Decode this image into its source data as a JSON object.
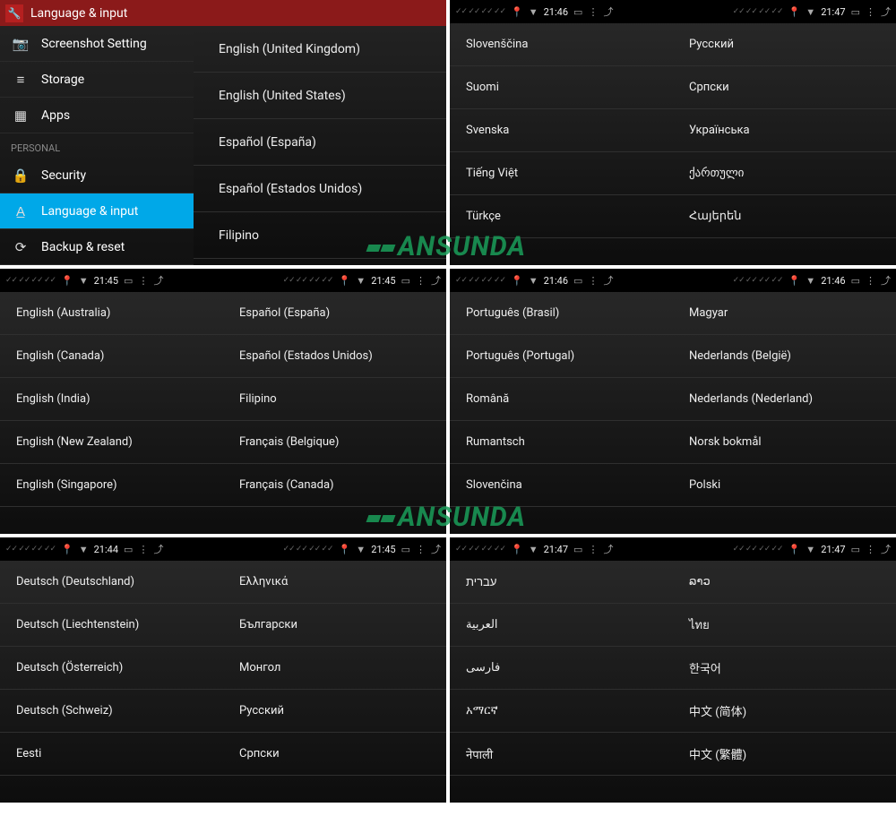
{
  "watermark": "ANSUNDA",
  "panels": {
    "p1": {
      "header": "Language & input",
      "sidebar": {
        "items": [
          {
            "icon": "📷",
            "label": "Screenshot Setting"
          },
          {
            "icon": "≡",
            "label": "Storage"
          },
          {
            "icon": "▦",
            "label": "Apps"
          }
        ],
        "section": "PERSONAL",
        "items2": [
          {
            "icon": "🔒",
            "label": "Security"
          },
          {
            "icon": "A̲",
            "label": "Language & input",
            "active": true
          },
          {
            "icon": "⟳",
            "label": "Backup & reset"
          }
        ]
      },
      "languages": [
        "English (United Kingdom)",
        "English (United States)",
        "Español (España)",
        "Español (Estados Unidos)",
        "Filipino"
      ]
    },
    "p2": {
      "status": {
        "left_time": "21:46",
        "right_time": "21:47"
      },
      "left": [
        "Slovenščina",
        "Suomi",
        "Svenska",
        "Tiếng Việt",
        "Türkçe"
      ],
      "right": [
        "Русский",
        "Српски",
        "Українська",
        "ქართული",
        "Հայերեն"
      ]
    },
    "p3": {
      "status": {
        "left_time": "21:45",
        "right_time": "21:45"
      },
      "left": [
        "English (Australia)",
        "English (Canada)",
        "English (India)",
        "English (New Zealand)",
        "English (Singapore)"
      ],
      "right": [
        "Español (España)",
        "Español (Estados Unidos)",
        "Filipino",
        "Français (Belgique)",
        "Français (Canada)"
      ]
    },
    "p4": {
      "status": {
        "left_time": "21:46",
        "right_time": "21:46"
      },
      "left": [
        "Português (Brasil)",
        "Português (Portugal)",
        "Română",
        "Rumantsch",
        "Slovenčina"
      ],
      "right": [
        "Magyar",
        "Nederlands (België)",
        "Nederlands (Nederland)",
        "Norsk bokmål",
        "Polski"
      ]
    },
    "p5": {
      "status": {
        "left_time": "21:44",
        "right_time": "21:45"
      },
      "left": [
        "Deutsch (Deutschland)",
        "Deutsch (Liechtenstein)",
        "Deutsch (Österreich)",
        "Deutsch (Schweiz)",
        "Eesti"
      ],
      "right": [
        "Ελληνικά",
        "Български",
        "Монгол",
        "Русский",
        "Српски"
      ]
    },
    "p6": {
      "status": {
        "left_time": "21:47",
        "right_time": "21:47"
      },
      "left": [
        "עברית",
        "العربية",
        "فارسی",
        "አማርኛ",
        "नेपाली"
      ],
      "right": [
        "ລາວ",
        "ไทย",
        "한국어",
        "中文 (简体)",
        "中文 (繁體)"
      ]
    }
  }
}
